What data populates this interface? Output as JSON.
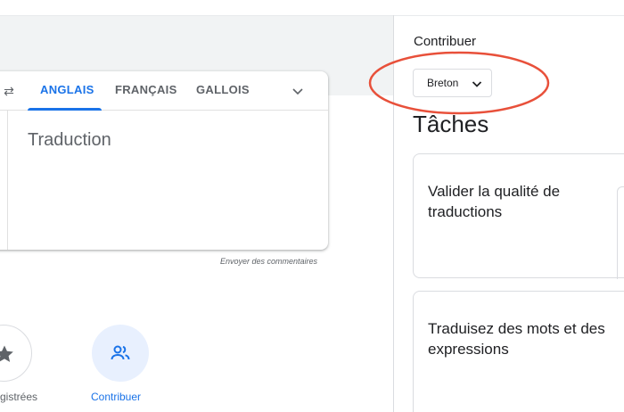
{
  "translate_card": {
    "tabs": [
      "ANGLAIS",
      "FRANÇAIS",
      "GALLOIS"
    ],
    "placeholder": "Traduction",
    "feedback_link": "Envoyer des commentaires"
  },
  "bottom_nav": {
    "saved_label": "gistrées",
    "contribute_label": "Contribuer"
  },
  "contribute_panel": {
    "title": "Contribuer",
    "language_select": "Breton",
    "tasks_heading": "Tâches",
    "tasks": [
      "Valider la qualité de traductions",
      "Traduisez des mots et des expressions"
    ]
  },
  "colors": {
    "accent": "#1a73e8",
    "highlight": "#e8503a"
  }
}
